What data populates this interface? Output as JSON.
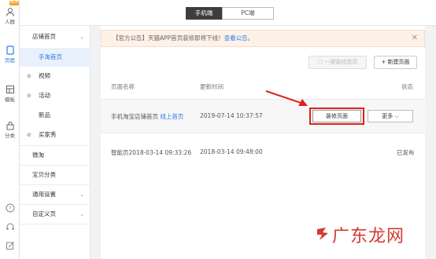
{
  "colors": {
    "accent": "#2f7ae5",
    "highlight_box": "#e02020",
    "arrow": "#e02020",
    "notice_bg": "#fdf1e8",
    "watermark": "#d43a2f"
  },
  "topbar": {
    "tabs": [
      {
        "label": "手机端",
        "active": true
      },
      {
        "label": "PC端",
        "active": false
      }
    ]
  },
  "rail": {
    "new_badge": "NEW",
    "items": [
      {
        "label": "人群",
        "icon": "user-icon"
      },
      {
        "label": "页面",
        "icon": "page-icon",
        "active": true
      },
      {
        "label": "模板",
        "icon": "template-icon"
      },
      {
        "label": "分类",
        "icon": "lock-icon"
      }
    ],
    "bottom_icons": [
      "help-icon",
      "headset-icon",
      "edit-icon"
    ]
  },
  "subnav": {
    "items": [
      {
        "label": "店铺首页",
        "chevron": "⌄"
      },
      {
        "label": "手淘首页",
        "selected": true
      },
      {
        "label": "视频",
        "icon": "⊘"
      },
      {
        "label": "活动",
        "icon": "⊘"
      },
      {
        "label": "新品"
      },
      {
        "label": "买家秀",
        "icon": "⊘"
      },
      {
        "label": "微淘"
      },
      {
        "label": "宝贝分类"
      },
      {
        "label": "通用设置",
        "chevron": "⌄"
      },
      {
        "label": "自定义页",
        "chevron": "⌄"
      }
    ]
  },
  "notice": {
    "prefix": "【官方公告】天猫APP首页装修即将下线！",
    "link": "查看公告。",
    "close": "✕"
  },
  "toolbar": {
    "one_click": "一键装修首页",
    "new_page": "+ 新建页面"
  },
  "table": {
    "headers": {
      "name": "页面名称",
      "updated": "更新时间",
      "status": "状态"
    },
    "rows": [
      {
        "name": "手机淘宝店铺首页",
        "tag": "线上首页",
        "updated": "2019-07-14 10:37:57",
        "edit": "装修页面",
        "more": "更多",
        "more_chevron": "⌵"
      },
      {
        "name": "智能页2018-03-14 09:33:26",
        "updated": "2018-03-14 09:48:00",
        "status": "已发布"
      }
    ]
  },
  "watermark": {
    "text": "广东龙网"
  }
}
